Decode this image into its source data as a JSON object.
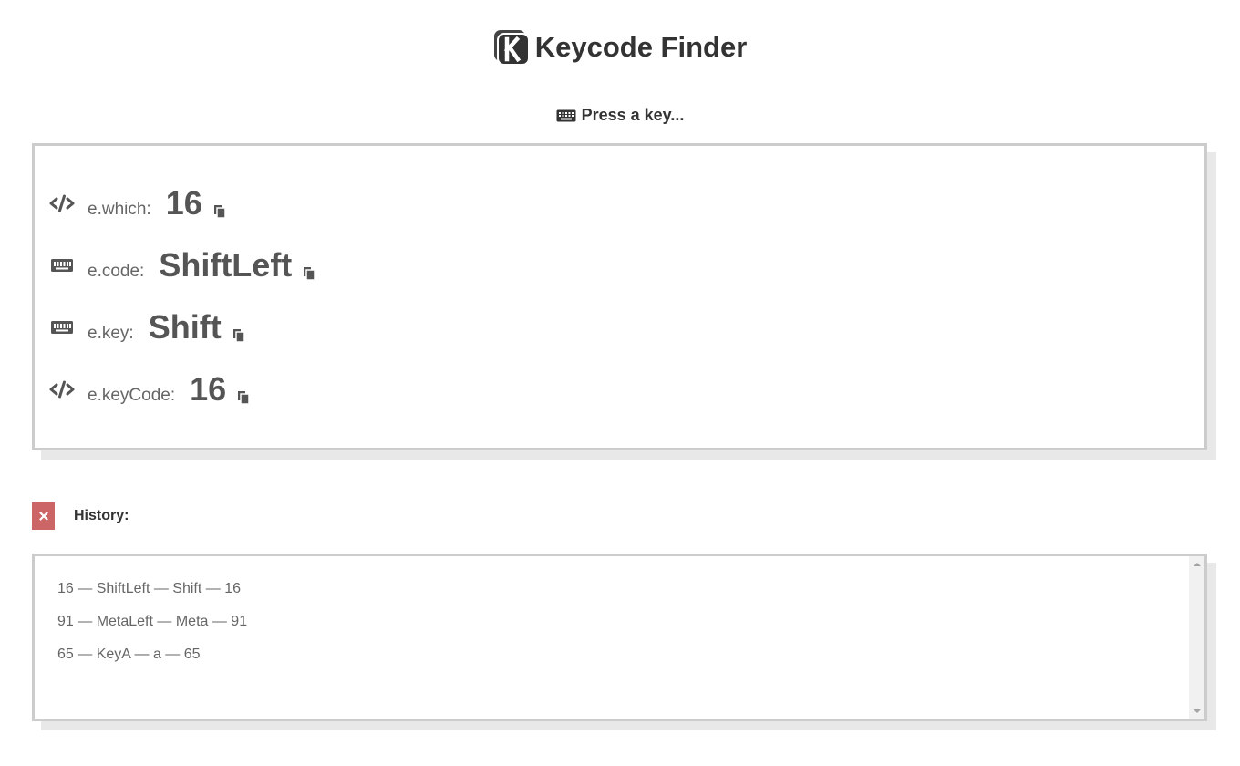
{
  "app": {
    "title": "Keycode Finder"
  },
  "prompt": {
    "text": "Press a key..."
  },
  "result": {
    "which": {
      "label": "e.which:",
      "value": "16"
    },
    "code": {
      "label": "e.code:",
      "value": "ShiftLeft"
    },
    "key": {
      "label": "e.key:",
      "value": "Shift"
    },
    "keyCode": {
      "label": "e.keyCode:",
      "value": "16"
    }
  },
  "icons": {
    "logo": "keycode-logo-icon",
    "prompt": "keyboard-icon",
    "which": "code-icon",
    "code": "keyboard-icon",
    "key": "keyboard-icon",
    "keyCode": "code-icon",
    "copy": "copy-icon",
    "clear": "close-icon"
  },
  "history": {
    "label": "History:",
    "items": [
      "16 — ShiftLeft — Shift — 16",
      "91 — MetaLeft — Meta — 91",
      "65 — KeyA — a — 65"
    ]
  },
  "colors": {
    "clear_button": "#cc6666",
    "panel_border": "#cccccc",
    "panel_shadow": "#e8e8e8",
    "text_dark": "#333333",
    "text_value": "#555555"
  }
}
